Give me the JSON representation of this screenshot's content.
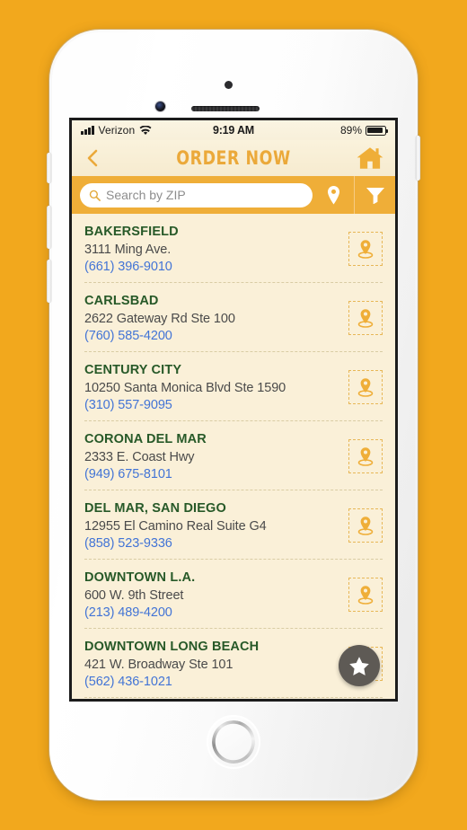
{
  "status_bar": {
    "carrier": "Verizon",
    "time": "9:19 AM",
    "battery_percent": "89%",
    "signal_icon": "signal-bars-icon",
    "wifi_icon": "wifi-icon",
    "battery_icon": "battery-icon"
  },
  "header": {
    "title": "ORDER NOW",
    "back_icon": "back-chevron-icon",
    "home_icon": "home-icon"
  },
  "search": {
    "placeholder": "Search by ZIP",
    "value": "",
    "search_icon": "search-icon",
    "location_icon": "map-pin-icon",
    "filter_icon": "filter-funnel-icon"
  },
  "fab": {
    "icon": "star-icon",
    "label": "Favorites"
  },
  "colors": {
    "brand_orange": "#EFAE38",
    "title_gold": "#EBA93A",
    "page_cream": "#FAF0D8",
    "city_green": "#275928",
    "phone_blue": "#4274D6",
    "divider_tan": "#D9CCA4",
    "fab_gray": "#5E5A55"
  },
  "locations": [
    {
      "city": "BAKERSFIELD",
      "address": "3111 Ming Ave.",
      "phone": "(661) 396-9010",
      "pin_icon": "map-pin-icon"
    },
    {
      "city": "CARLSBAD",
      "address": "2622 Gateway Rd Ste 100",
      "phone": "(760) 585-4200",
      "pin_icon": "map-pin-icon"
    },
    {
      "city": "CENTURY CITY",
      "address": "10250 Santa Monica Blvd Ste 1590",
      "phone": "(310) 557-9095",
      "pin_icon": "map-pin-icon"
    },
    {
      "city": "CORONA DEL MAR",
      "address": "2333 E. Coast Hwy",
      "phone": "(949) 675-8101",
      "pin_icon": "map-pin-icon"
    },
    {
      "city": "DEL MAR, SAN DIEGO",
      "address": "12955 El Camino Real Suite G4",
      "phone": "(858) 523-9336",
      "pin_icon": "map-pin-icon"
    },
    {
      "city": "DOWNTOWN L.A.",
      "address": "600 W. 9th Street",
      "phone": "(213) 489-4200",
      "pin_icon": "map-pin-icon"
    },
    {
      "city": "DOWNTOWN LONG BEACH",
      "address": "421 W. Broadway Ste 101",
      "phone": "(562) 436-1021",
      "pin_icon": "map-pin-icon"
    }
  ]
}
